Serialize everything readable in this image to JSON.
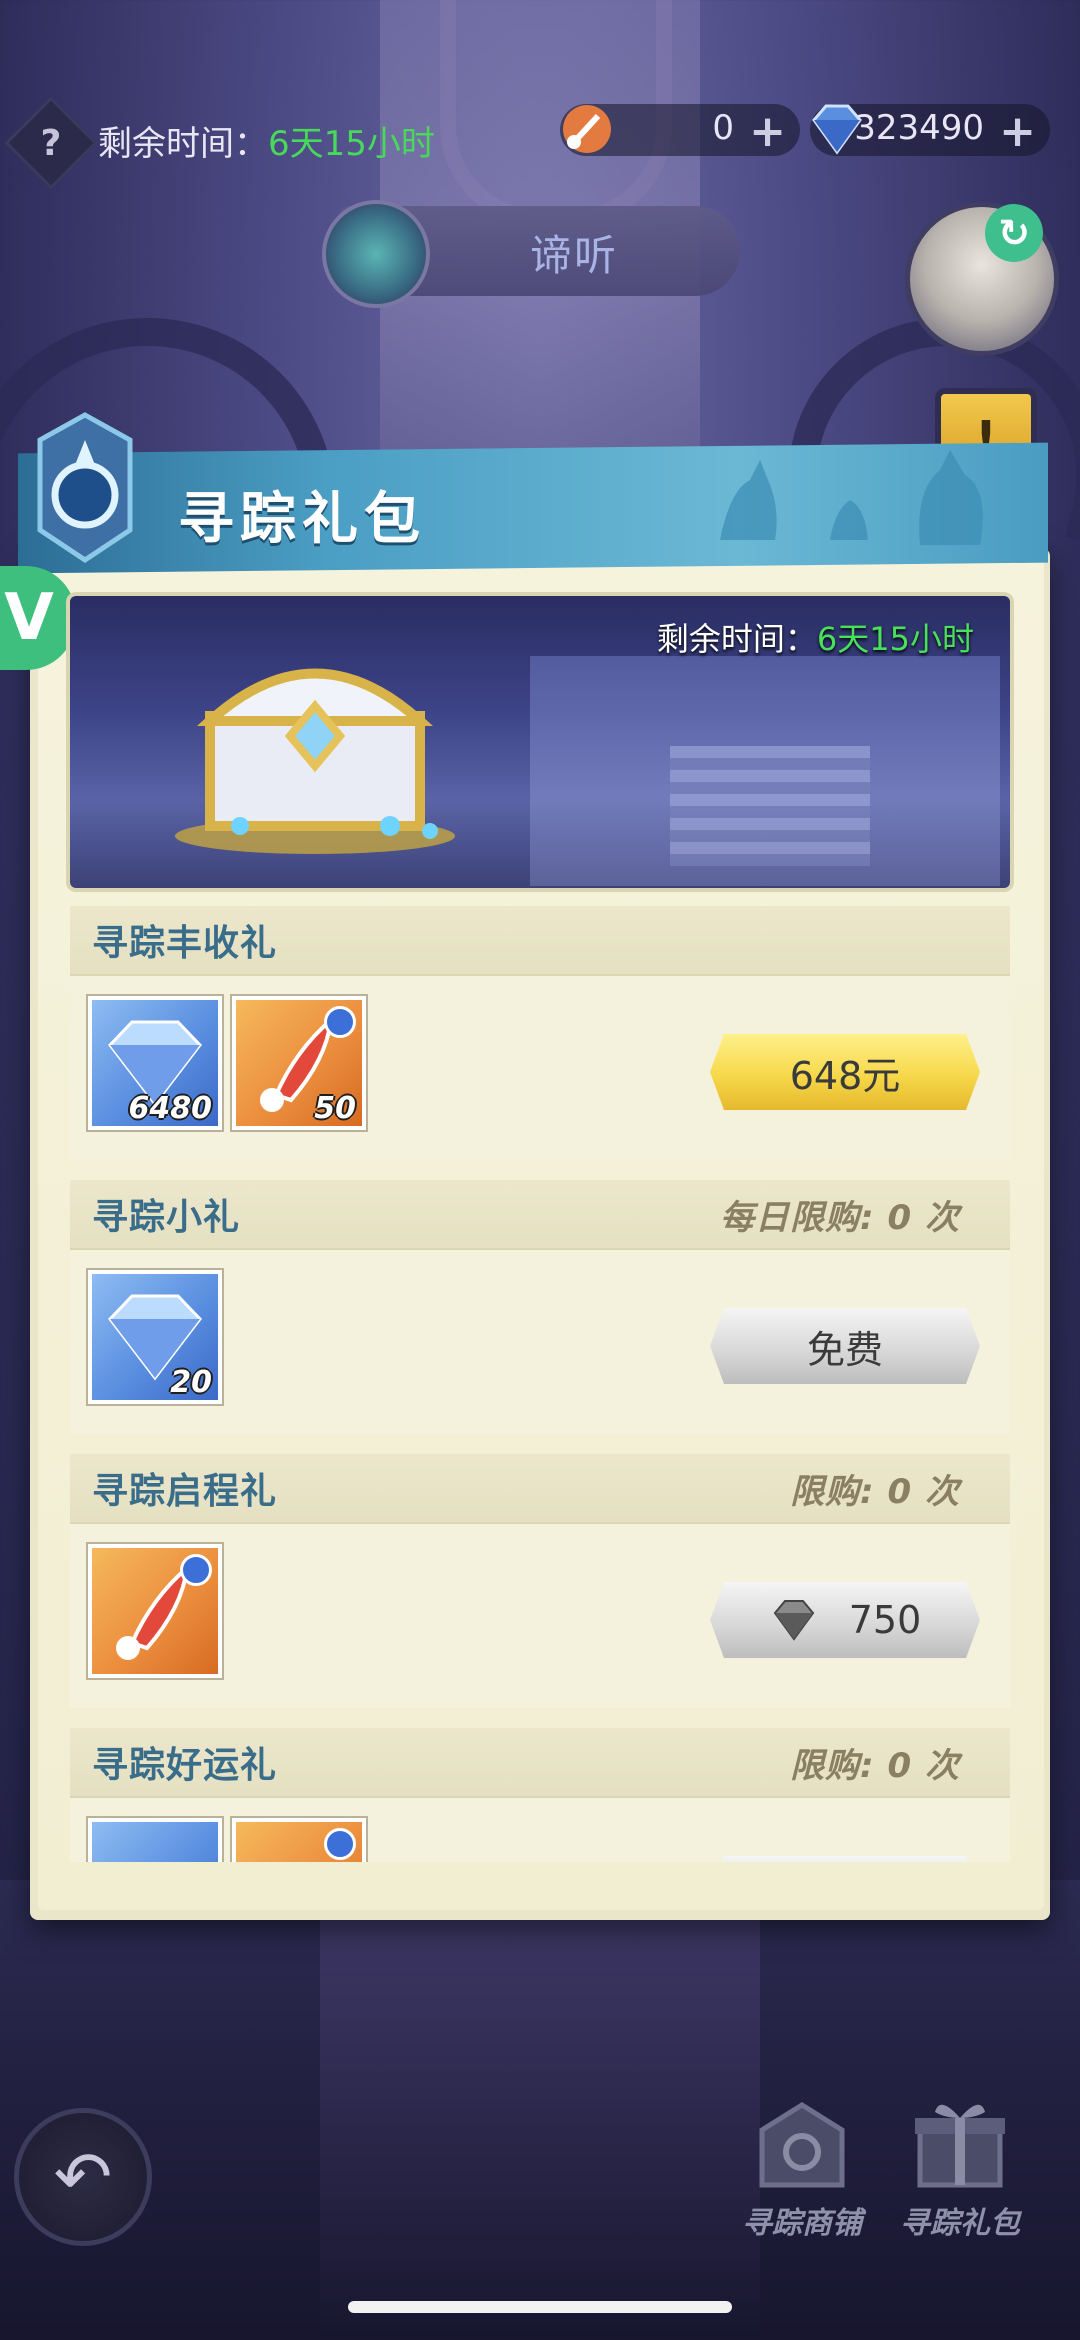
{
  "top_bar": {
    "help_icon": "question-icon",
    "time_label": "剩余时间：",
    "time_value": "6天15小时",
    "resource1": {
      "icon": "feather-item-icon",
      "value": "0"
    },
    "resource2": {
      "icon": "diamond-icon",
      "value": "323490"
    },
    "plus": "+"
  },
  "listen": {
    "label": "谛听"
  },
  "side": {
    "refresh_glyph": "↻",
    "alert_glyph": "!"
  },
  "panel": {
    "title": "寻踪礼包",
    "v_badge": "V",
    "hero_time_label": "剩余时间：",
    "hero_time_value": "6天15小时"
  },
  "packs": [
    {
      "name": "寻踪丰收礼",
      "limit": "",
      "items": [
        {
          "type": "diamond",
          "qty": "6480"
        },
        {
          "type": "feather",
          "qty": "50"
        }
      ],
      "button": {
        "style": "gold",
        "label": "648元"
      }
    },
    {
      "name": "寻踪小礼",
      "limit": "每日限购: 0 次",
      "items": [
        {
          "type": "diamond",
          "qty": "20"
        }
      ],
      "button": {
        "style": "silver",
        "label": "免费"
      }
    },
    {
      "name": "寻踪启程礼",
      "limit": "限购: 0 次",
      "items": [
        {
          "type": "feather",
          "qty": ""
        }
      ],
      "button": {
        "style": "silver",
        "label": "750",
        "icon": "gray-diamond-icon"
      }
    },
    {
      "name": "寻踪好运礼",
      "limit": "限购: 0 次",
      "items": [
        {
          "type": "diamond",
          "qty": ""
        },
        {
          "type": "feather",
          "qty": ""
        }
      ],
      "button": {
        "style": "silver",
        "label": ""
      }
    }
  ],
  "bottom_nav": {
    "back_glyph": "↶",
    "shop_label": "寻踪商铺",
    "gift_label": "寻踪礼包"
  },
  "colors": {
    "timer_green": "#48d95a",
    "title_blue": "#3a6d8a",
    "gold_button": "#f6d84a"
  }
}
